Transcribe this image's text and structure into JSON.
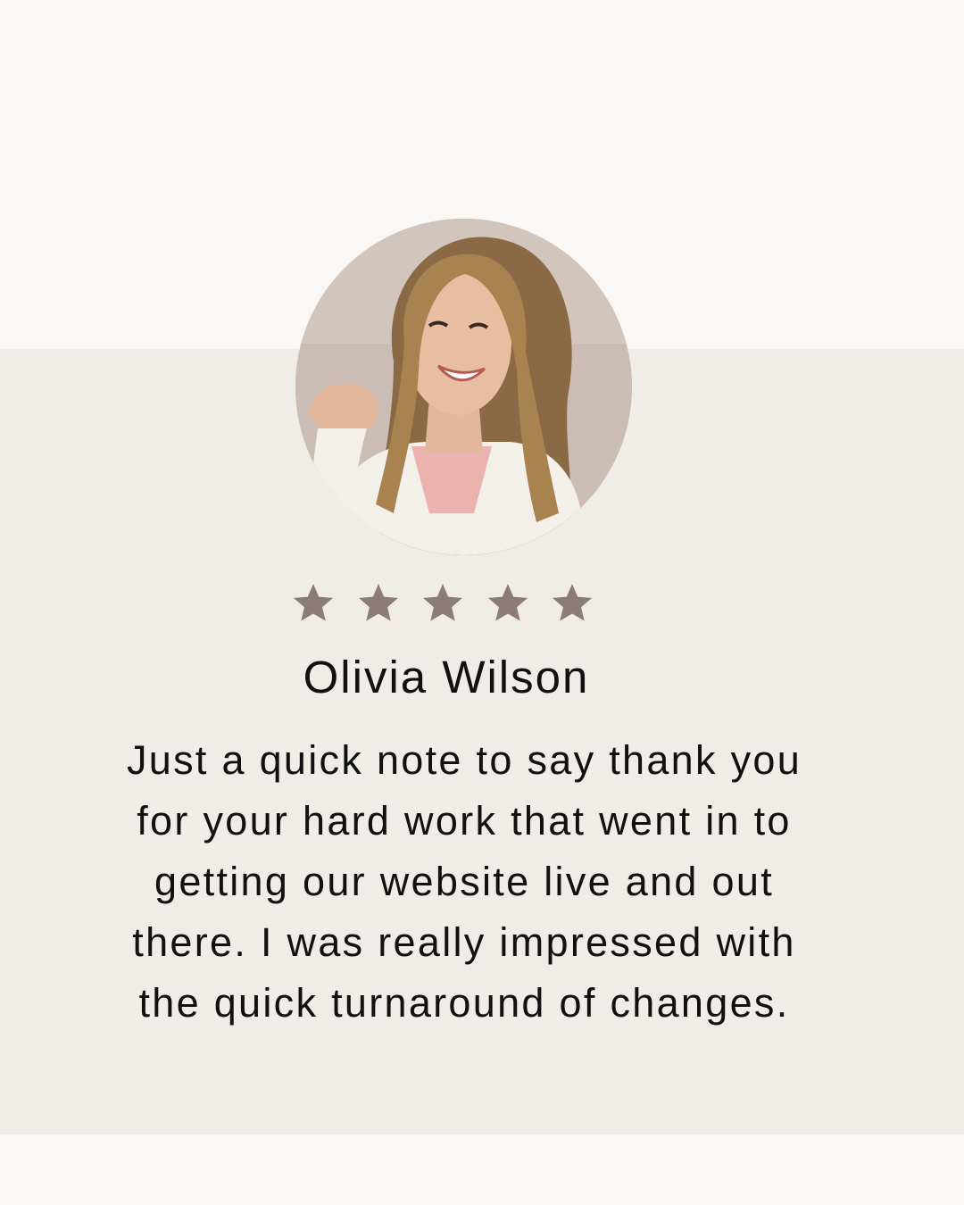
{
  "testimonial": {
    "name": "Olivia Wilson",
    "rating": 5,
    "rating_max": 5,
    "quote": "Just a quick note to say thank you for your hard work that went in to getting our website live and out there. I was really impressed with the quick turnaround of changes."
  },
  "colors": {
    "page_background": "#f9f8f6",
    "band_background": "#f0ede9",
    "star": "#8c7b77",
    "text": "#111111"
  },
  "icons": {
    "star": "star-icon",
    "avatar": "portrait-photo"
  }
}
